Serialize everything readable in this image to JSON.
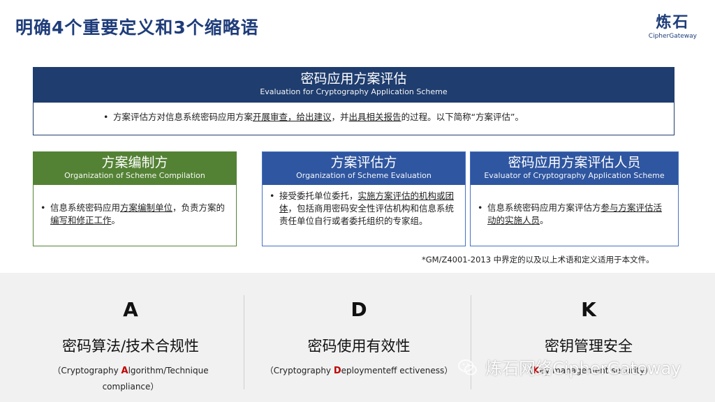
{
  "title": "明确4个重要定义和3个缩略语",
  "logo": {
    "cn": "炼石",
    "en": "CipherGateway"
  },
  "main": {
    "cn": "密码应用方案评估",
    "en": "Evaluation for Cryptography Application Scheme",
    "text_a": "方案评估方对信息系统密码应用方案",
    "text_u1": "开展审查，给出建议",
    "text_b": "，并",
    "text_u2": "出具相关报告",
    "text_c": "的过程。以下简称“方案评估”。"
  },
  "cards": [
    {
      "cn": "方案编制方",
      "en": "Organization of Scheme Compilation",
      "text_a": "信息系统密码应用",
      "text_u1": "方案编制单位",
      "text_b": "，负责方案的",
      "text_u2": "编写和修正工作",
      "text_c": "。",
      "color": "#548235"
    },
    {
      "cn": "方案评估方",
      "en": "Organization of Scheme Evaluation",
      "text_a": "接受委托单位委托，",
      "text_u1": "实施方案评估的机构或团体",
      "text_b": "，包括商用密码安全性评估机构和信息系统责任单位自行或者委托组织的专家组。",
      "color": "#2f56a0"
    },
    {
      "cn": "密码应用方案评估人员",
      "en": "Evaluator of Cryptography Application Scheme",
      "text_a": "信息系统密码应用方案评估方",
      "text_u1": "参与方案评估活动的实施人员",
      "text_b": "。",
      "color": "#2f56a0"
    }
  ],
  "note": "*GM/Z4001-2013 中界定的以及以上术语和定义适用于本文件。",
  "abbreviations": [
    {
      "letter": "A",
      "cn": "密码算法/技术合规性",
      "en_a": "（Cryptography ",
      "en_hl": "A",
      "en_b": "lgorithm/Technique",
      "en_c": "compliance）"
    },
    {
      "letter": "D",
      "cn": "密码使用有效性",
      "en_a": "（Cryptography ",
      "en_hl": "D",
      "en_b": "eploymenteff ectiveness）"
    },
    {
      "letter": "K",
      "cn": "密钥管理安全",
      "en_a": "（",
      "en_hl": "K",
      "en_b": "ey management security）"
    }
  ],
  "watermark": "炼石网络CipherGateway"
}
